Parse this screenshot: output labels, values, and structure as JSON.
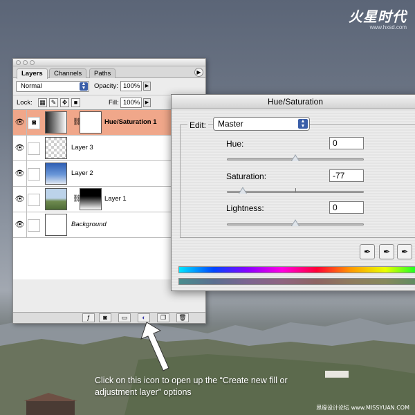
{
  "branding": {
    "logo": "火星时代",
    "url": "www.hxsd.com",
    "watermark": "思缘设计论坛 www.MISSYUAN.COM"
  },
  "layers_panel": {
    "tabs": [
      "Layers",
      "Channels",
      "Paths"
    ],
    "blend_mode": "Normal",
    "opacity_label": "Opacity:",
    "opacity_value": "100%",
    "lock_label": "Lock:",
    "fill_label": "Fill:",
    "fill_value": "100%",
    "layers": [
      {
        "name": "Hue/Saturation 1",
        "selected": true,
        "type": "adjustment"
      },
      {
        "name": "Layer 3",
        "selected": false,
        "type": "transparent"
      },
      {
        "name": "Layer 2",
        "selected": false,
        "type": "sky"
      },
      {
        "name": "Layer 1",
        "selected": false,
        "type": "landscape-mask"
      },
      {
        "name": "Background",
        "selected": false,
        "type": "white"
      }
    ]
  },
  "hue_saturation": {
    "title": "Hue/Saturation",
    "edit_label": "Edit:",
    "edit_value": "Master",
    "hue_label": "Hue:",
    "hue_value": "0",
    "hue_level": 0,
    "saturation_label": "Saturation:",
    "saturation_value": "-77",
    "saturation_level": -77,
    "lightness_label": "Lightness:",
    "lightness_value": "0",
    "lightness_level": 0
  },
  "callout": {
    "text": "Click on this icon to open up the “Create new fill or adjustment layer” options"
  }
}
